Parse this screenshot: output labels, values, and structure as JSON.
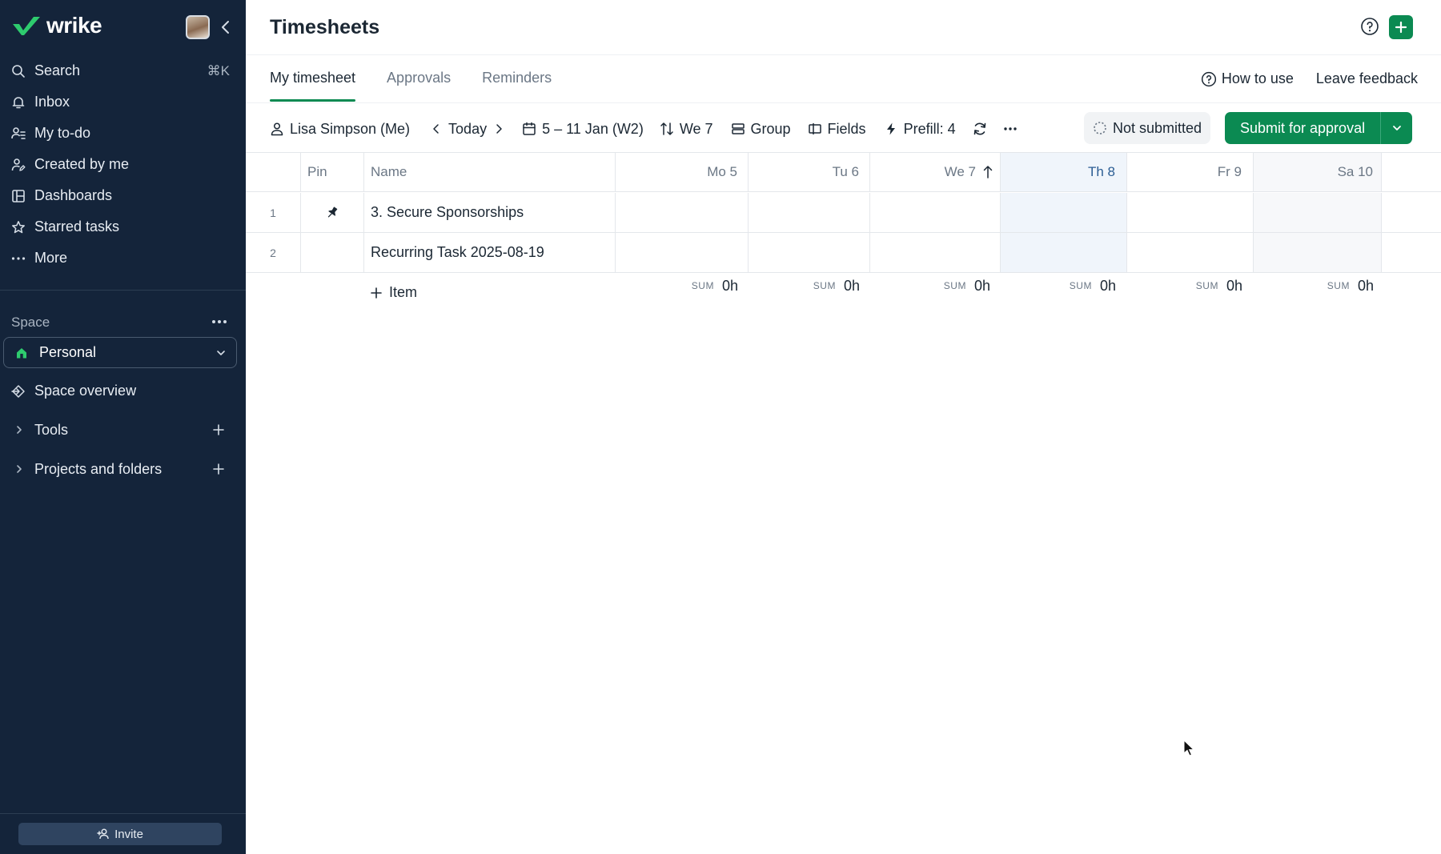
{
  "app": {
    "brand": "wrike",
    "accent": "#0b8a52",
    "sidebar_bg": "#14243a"
  },
  "sidebar": {
    "nav": [
      {
        "label": "Search",
        "icon": "search-icon",
        "shortcut": "⌘K"
      },
      {
        "label": "Inbox",
        "icon": "bell-icon"
      },
      {
        "label": "My to-do",
        "icon": "user-list-icon"
      },
      {
        "label": "Created by me",
        "icon": "user-edit-icon"
      },
      {
        "label": "Dashboards",
        "icon": "dashboard-icon"
      },
      {
        "label": "Starred tasks",
        "icon": "star-icon"
      },
      {
        "label": "More",
        "icon": "ellipsis-icon"
      }
    ],
    "space_label": "Space",
    "space_selected": "Personal",
    "space_overview": "Space overview",
    "tools": "Tools",
    "projects": "Projects and folders",
    "invite": "Invite"
  },
  "header": {
    "title": "Timesheets"
  },
  "tabs": [
    {
      "label": "My timesheet",
      "active": true
    },
    {
      "label": "Approvals",
      "active": false
    },
    {
      "label": "Reminders",
      "active": false
    }
  ],
  "tab_actions": {
    "how_to_use": "How to use",
    "leave_feedback": "Leave feedback"
  },
  "toolbar": {
    "user": "Lisa Simpson (Me)",
    "today": "Today",
    "range": "5 – 11 Jan (W2)",
    "sort": "We 7",
    "group": "Group",
    "fields": "Fields",
    "prefill": "Prefill: 4",
    "status": "Not submitted",
    "submit": "Submit for approval"
  },
  "grid": {
    "columns": {
      "pin": "Pin",
      "name": "Name",
      "days": [
        "Mo 5",
        "Tu 6",
        "We 7",
        "Th 8",
        "Fr 9",
        "Sa 10"
      ]
    },
    "rows": [
      {
        "num": "1",
        "pinned": true,
        "name": "3. Secure Sponsorships"
      },
      {
        "num": "2",
        "pinned": false,
        "name": "Recurring Task 2025-08-19"
      }
    ],
    "add_item": "Item",
    "sum_label": "SUM",
    "sums": [
      "0h",
      "0h",
      "0h",
      "0h",
      "0h",
      "0h"
    ]
  }
}
